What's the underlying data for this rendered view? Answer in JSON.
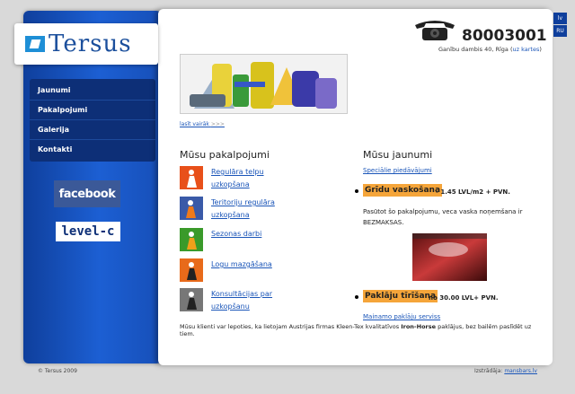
{
  "logo": {
    "text": "Tersus"
  },
  "nav": {
    "items": [
      "Jaunumi",
      "Pakalpojumi",
      "Galerija",
      "Kontakti"
    ]
  },
  "social": {
    "facebook": "facebook",
    "levelc": "level-c"
  },
  "lang": {
    "lv": "lv",
    "ru": "RU"
  },
  "contact": {
    "phone": "80003001",
    "address": "Ganību dambis 40, Rīga",
    "map_link": "uz kartes"
  },
  "hero": {
    "read_more": "lasīt vairāk",
    "read_more_arrow": ">>>"
  },
  "services": {
    "title": "Mūsu pakalpojumi",
    "items": [
      "Regulāra telpu uzkopšana",
      "Teritoriju regulāra uzkopšana",
      "Sezonas darbi",
      "Logu mazgāšana",
      "Konsultācijas par uzkopšanu"
    ]
  },
  "news": {
    "title": "Mūsu jaunumi",
    "special_link": "Speciālie piedāvājumi",
    "item1_title": "Grīdu vaskošana",
    "item1_price": "- 1.45 LVL/m2 + PVN.",
    "item1_desc": "Pasūtot šo pakalpojumu, veca vaska noņemšana ir BEZMAKSAS.",
    "item2_title": "Paklāju tīrīšana",
    "item2_price": "no 30.00 LVL+ PVN.",
    "item2_link": "Mainamo paklāju serviss"
  },
  "note": {
    "pre": "Mūsu klienti var lepoties, ka lietojam Austrijas firmas Kleen-Tex kvalitatīvos",
    "brand": "Iron-Horse",
    "post": "paklājus, bez bailēm paslīdēt uz tiem."
  },
  "footer": {
    "copyright": "© Tersus 2009",
    "made_by_label": "Izstrādāja:",
    "made_by_link": "mansbars.lv"
  }
}
